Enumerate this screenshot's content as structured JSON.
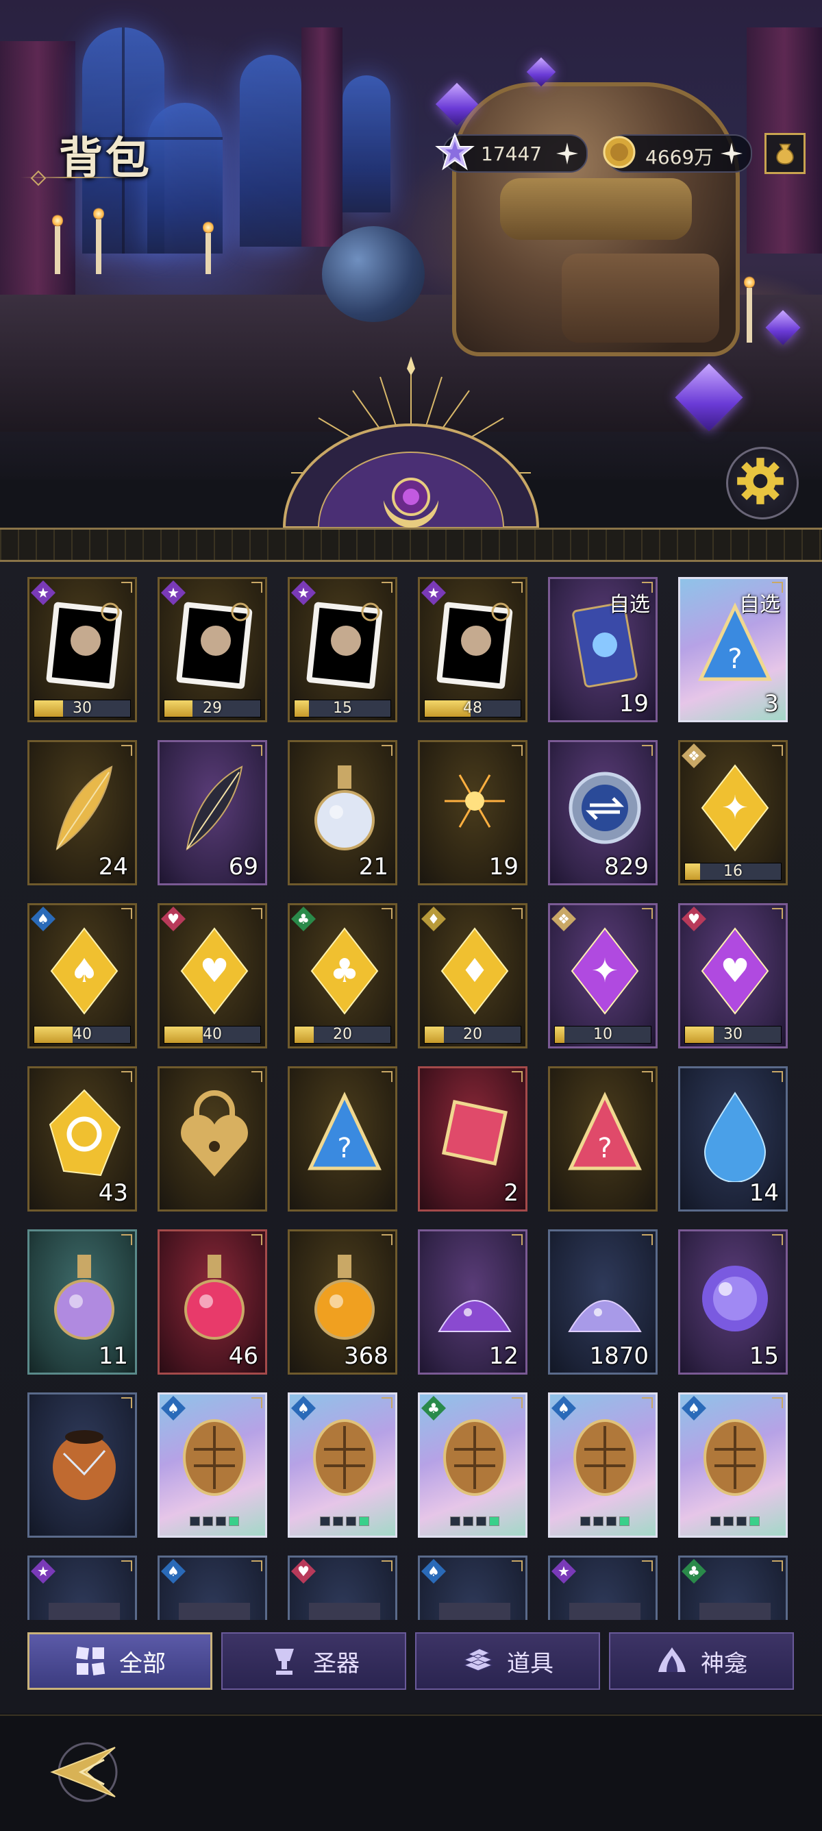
{
  "header": {
    "title": "背包",
    "currencies": [
      {
        "icon": "star-crystal-icon",
        "value": "17447"
      },
      {
        "icon": "gold-coin-icon",
        "value": "4669万"
      }
    ]
  },
  "grid": {
    "rows": [
      [
        {
          "kind": "puzzle",
          "quality": "gold",
          "badge": "star",
          "art": "portrait-puzzle-silver-hair",
          "face": "#b8c4d4",
          "progress": "30",
          "fill": 0.3
        },
        {
          "kind": "puzzle",
          "quality": "gold",
          "badge": "star",
          "art": "portrait-puzzle-blonde",
          "face": "#d4a070",
          "progress": "29",
          "fill": 0.29
        },
        {
          "kind": "puzzle",
          "quality": "gold",
          "badge": "star",
          "art": "portrait-puzzle-dark-hair",
          "face": "#6a3a40",
          "progress": "15",
          "fill": 0.15
        },
        {
          "kind": "puzzle",
          "quality": "gold",
          "badge": "star",
          "art": "portrait-puzzle-gold-crown",
          "face": "#3a2a24",
          "progress": "48",
          "fill": 0.48
        },
        {
          "kind": "count",
          "quality": "purple",
          "pick": "自选",
          "art": "selectable-card-pack",
          "count": "19"
        },
        {
          "kind": "count",
          "quality": "rainbow",
          "pick": "自选",
          "art": "selectable-mystery-triangle",
          "count": "3"
        }
      ],
      [
        {
          "kind": "count",
          "quality": "gold",
          "art": "golden-feather",
          "count": "24"
        },
        {
          "kind": "count",
          "quality": "purple",
          "art": "dark-feather",
          "count": "69"
        },
        {
          "kind": "count",
          "quality": "gold",
          "art": "pearl-potion-bottle",
          "count": "21"
        },
        {
          "kind": "count",
          "quality": "gold",
          "art": "firework-burst",
          "count": "19"
        },
        {
          "kind": "count",
          "quality": "purple",
          "art": "silver-exchange-coin",
          "count": "829"
        },
        {
          "kind": "bar",
          "quality": "gold",
          "badge": "puzzle",
          "art": "gold-crystal-keyhole",
          "progress": "16",
          "fill": 0.16
        }
      ],
      [
        {
          "kind": "bar",
          "quality": "gold",
          "badge": "spade",
          "art": "gold-crystal-spade",
          "progress": "40",
          "fill": 0.4
        },
        {
          "kind": "bar",
          "quality": "gold",
          "badge": "heart",
          "art": "gold-crystal-heart",
          "progress": "40",
          "fill": 0.4
        },
        {
          "kind": "bar",
          "quality": "gold",
          "badge": "club",
          "art": "gold-crystal-club",
          "progress": "20",
          "fill": 0.2
        },
        {
          "kind": "bar",
          "quality": "gold",
          "badge": "diamond",
          "art": "gold-crystal-diamond",
          "progress": "20",
          "fill": 0.2
        },
        {
          "kind": "bar",
          "quality": "purple",
          "badge": "puzzle",
          "art": "purple-crystal-keyhole",
          "progress": "10",
          "fill": 0.1
        },
        {
          "kind": "bar",
          "quality": "purple",
          "badge": "heart",
          "art": "purple-crystal-heart",
          "progress": "30",
          "fill": 0.3
        }
      ],
      [
        {
          "kind": "count",
          "quality": "gold",
          "art": "yellow-refresh-gem",
          "count": "43"
        },
        {
          "kind": "count",
          "quality": "gold",
          "art": "golden-heart-padlock",
          "count": ""
        },
        {
          "kind": "count",
          "quality": "gold",
          "art": "blue-triangle-token",
          "count": ""
        },
        {
          "kind": "count",
          "quality": "red",
          "art": "red-square-token",
          "count": "2"
        },
        {
          "kind": "count",
          "quality": "gold",
          "art": "red-triangle-token",
          "count": ""
        },
        {
          "kind": "count",
          "quality": "navy",
          "art": "blue-water-drop-gem",
          "count": "14"
        }
      ],
      [
        {
          "kind": "count",
          "quality": "teal",
          "art": "rainbow-heart-potion",
          "count": "11"
        },
        {
          "kind": "count",
          "quality": "red",
          "art": "red-heart-potion",
          "count": "46"
        },
        {
          "kind": "count",
          "quality": "gold",
          "art": "amber-orb-potion",
          "count": "368"
        },
        {
          "kind": "count",
          "quality": "purple",
          "art": "purple-crystal-dust",
          "count": "12"
        },
        {
          "kind": "count",
          "quality": "navy",
          "art": "violet-sand-pile",
          "count": "1870"
        },
        {
          "kind": "count",
          "quality": "purple",
          "art": "glowing-purple-orb",
          "count": "15"
        }
      ],
      [
        {
          "kind": "count",
          "quality": "navy",
          "art": "clay-cracked-pot",
          "count": ""
        },
        {
          "kind": "relic",
          "quality": "rainbow",
          "badge": "spade",
          "art": "shield-relic-card",
          "level": 1
        },
        {
          "kind": "relic",
          "quality": "rainbow",
          "badge": "spade",
          "art": "shield-relic-card",
          "level": 1
        },
        {
          "kind": "relic",
          "quality": "rainbow",
          "badge": "club",
          "art": "shield-relic-card",
          "level": 1
        },
        {
          "kind": "relic",
          "quality": "rainbow",
          "badge": "spade",
          "art": "shield-relic-card",
          "level": 1
        },
        {
          "kind": "relic",
          "quality": "rainbow",
          "badge": "spade",
          "art": "shield-relic-card",
          "level": 1
        }
      ],
      [
        {
          "kind": "count",
          "quality": "navy",
          "badge": "star",
          "art": "relic-card-partial",
          "count": ""
        },
        {
          "kind": "count",
          "quality": "navy",
          "badge": "spade",
          "art": "relic-card-partial",
          "count": ""
        },
        {
          "kind": "count",
          "quality": "navy",
          "badge": "heart",
          "art": "relic-card-partial",
          "count": ""
        },
        {
          "kind": "count",
          "quality": "navy",
          "badge": "spade",
          "art": "relic-card-partial",
          "count": ""
        },
        {
          "kind": "count",
          "quality": "navy",
          "badge": "star",
          "art": "relic-card-partial",
          "count": ""
        },
        {
          "kind": "count",
          "quality": "navy",
          "badge": "club",
          "art": "relic-card-partial",
          "count": ""
        }
      ]
    ]
  },
  "tabs": [
    {
      "label": "全部",
      "icon": "all-grid-icon",
      "active": true
    },
    {
      "label": "圣器",
      "icon": "relic-chalice-icon",
      "active": false
    },
    {
      "label": "道具",
      "icon": "items-stack-icon",
      "active": false
    },
    {
      "label": "神龛",
      "icon": "shrine-icon",
      "active": false
    }
  ],
  "colors": {
    "gold_frame": "#c9a866",
    "accent_purple": "#7a5a94",
    "bar_fill": "#e2bd48",
    "tab_active": "#5b5aa8"
  }
}
